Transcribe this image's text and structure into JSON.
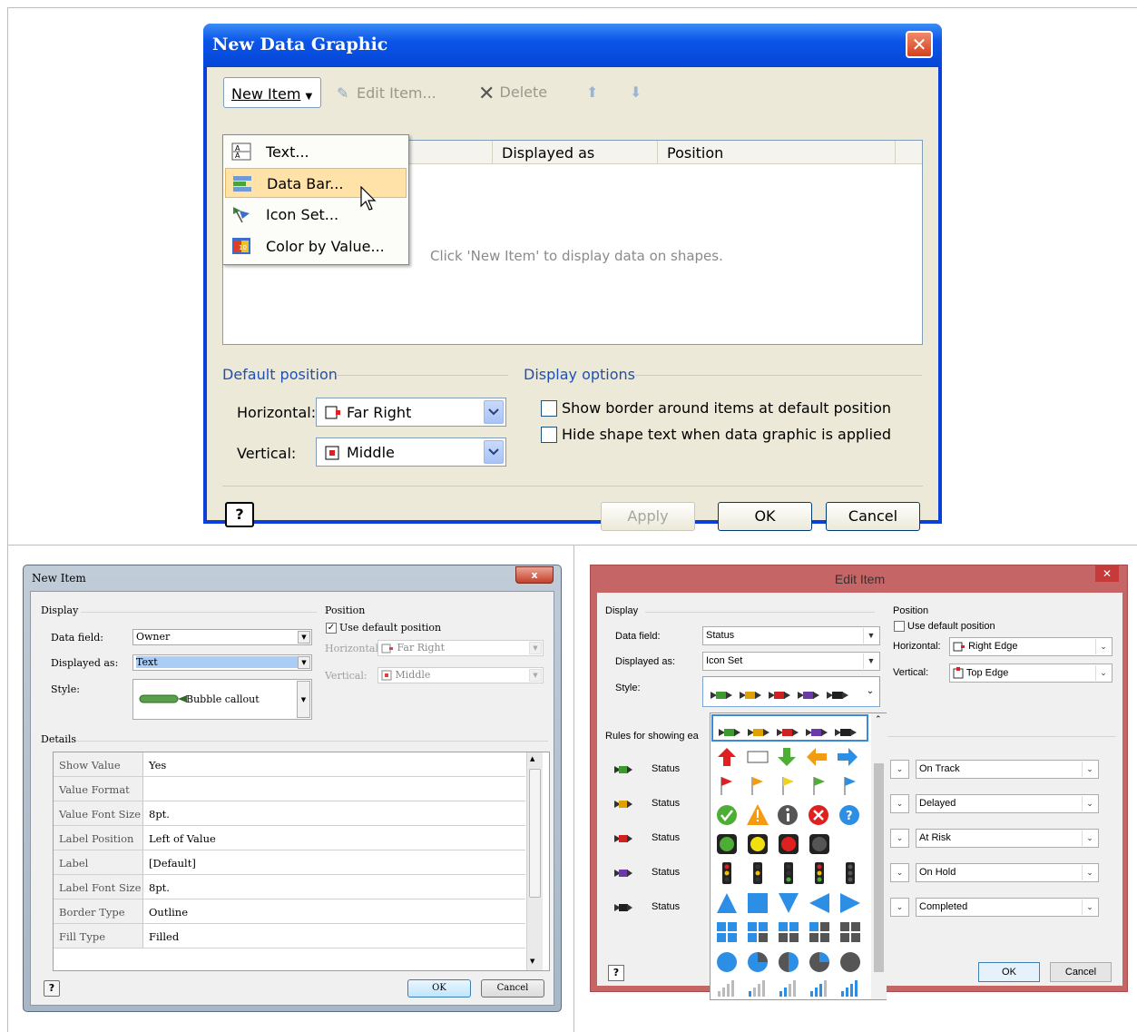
{
  "panel1": {
    "title": "New Data Graphic",
    "close_label": "✕",
    "toolbar": {
      "new_item": "New Item",
      "edit_item": "Edit Item...",
      "delete": "Delete"
    },
    "menu": [
      {
        "label": "Text...",
        "icon": "text-icon"
      },
      {
        "label": "Data Bar...",
        "icon": "data-bar-icon"
      },
      {
        "label": "Icon Set...",
        "icon": "icon-set-icon"
      },
      {
        "label": "Color by Value...",
        "icon": "color-by-value-icon"
      }
    ],
    "columns": [
      "Displayed as",
      "Position"
    ],
    "empty_hint": "Click 'New Item' to display data on shapes.",
    "default_position": {
      "label": "Default position",
      "horizontal_label": "Horizontal:",
      "horizontal_value": "Far Right",
      "vertical_label": "Vertical:",
      "vertical_value": "Middle"
    },
    "display_options": {
      "label": "Display options",
      "opt1": "Show border around items at default position",
      "opt2": "Hide shape text when data graphic is applied"
    },
    "buttons": {
      "apply": "Apply",
      "ok": "OK",
      "cancel": "Cancel"
    },
    "help": "?"
  },
  "panel2": {
    "title": "New Item",
    "close_label": "x",
    "display_label": "Display",
    "data_field_label": "Data field:",
    "data_field_value": "Owner",
    "displayed_as_label": "Displayed as:",
    "displayed_as_value": "Text",
    "style_label": "Style:",
    "style_value": "Bubble callout",
    "position_label": "Position",
    "use_default": "Use default position",
    "horizontal_label": "Horizontal:",
    "horizontal_value": "Far Right",
    "vertical_label": "Vertical:",
    "vertical_value": "Middle",
    "details_label": "Details",
    "details": [
      {
        "k": "Show Value",
        "v": "Yes"
      },
      {
        "k": "Value Format",
        "v": ""
      },
      {
        "k": "Value Font Size",
        "v": "8pt."
      },
      {
        "k": "Label Position",
        "v": "Left of Value"
      },
      {
        "k": "Label",
        "v": "[Default]"
      },
      {
        "k": "Label Font Size",
        "v": "8pt."
      },
      {
        "k": "Border Type",
        "v": "Outline"
      },
      {
        "k": "Fill Type",
        "v": "Filled"
      }
    ],
    "ok": "OK",
    "cancel": "Cancel",
    "help": "?"
  },
  "panel3": {
    "title": "Edit Item",
    "close_label": "✕",
    "display_label": "Display",
    "data_field_label": "Data field:",
    "data_field_value": "Status",
    "displayed_as_label": "Displayed as:",
    "displayed_as_value": "Icon Set",
    "style_label": "Style:",
    "position_label": "Position",
    "use_default": "Use default position",
    "horizontal_label": "Horizontal:",
    "horizontal_value": "Right Edge",
    "vertical_label": "Vertical:",
    "vertical_value": "Top Edge",
    "rules_label": "Rules for showing ea",
    "rules": [
      {
        "field": "Status",
        "value": "On Track",
        "color": "#3c9a2e"
      },
      {
        "field": "Status",
        "value": "Delayed",
        "color": "#e0a000"
      },
      {
        "field": "Status",
        "value": "At Risk",
        "color": "#d02020"
      },
      {
        "field": "Status",
        "value": "On Hold",
        "color": "#6a3aa8"
      },
      {
        "field": "Status",
        "value": "Completed",
        "color": "#202020"
      }
    ],
    "ok": "OK",
    "cancel": "Cancel",
    "help": "?"
  }
}
